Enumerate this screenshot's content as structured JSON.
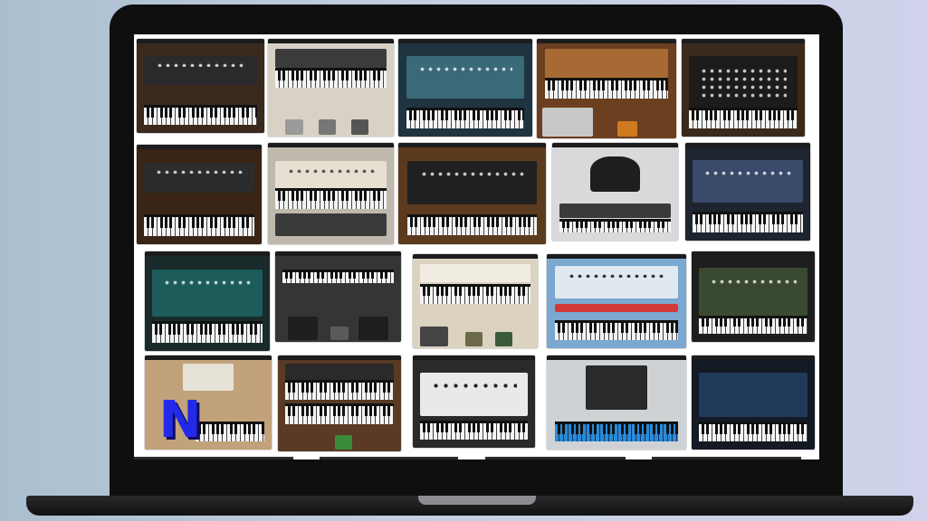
{
  "screen": {
    "content": "collage",
    "tiles": [
      {
        "name": "synth-tile-1",
        "bg": "#3a2a1e",
        "panel": "#2a2a2c"
      },
      {
        "name": "synth-tile-2",
        "bg": "#d8d2c6",
        "panel": "#3b3b3b"
      },
      {
        "name": "synth-tile-3",
        "bg": "#1e3440",
        "panel": "#3a6a78"
      },
      {
        "name": "synth-tile-4",
        "bg": "#6b3f1f",
        "panel": "#a86a34"
      },
      {
        "name": "synth-tile-5",
        "bg": "#3a2a1c",
        "panel": "#1c1c1c"
      },
      {
        "name": "synth-tile-6",
        "bg": "#3a2415",
        "panel": "#2c2c2c"
      },
      {
        "name": "synth-tile-7",
        "bg": "#bfb9ad",
        "panel": "#e6e0d2"
      },
      {
        "name": "synth-tile-8",
        "bg": "#5c3a1e",
        "panel": "#202020"
      },
      {
        "name": "synth-tile-9",
        "bg": "#d9d9db",
        "panel": "#1e1e1e"
      },
      {
        "name": "synth-tile-10",
        "bg": "#1e2430",
        "panel": "#3a4a6a"
      },
      {
        "name": "synth-tile-11",
        "bg": "#1a2a2a",
        "panel": "#1c5c5a"
      },
      {
        "name": "synth-tile-12",
        "bg": "#353535",
        "panel": "#a0a0a0"
      },
      {
        "name": "synth-tile-13",
        "bg": "#dbd2c0",
        "panel": "#f1ece2"
      },
      {
        "name": "synth-tile-14",
        "bg": "#7aa8d0",
        "panel": "#e0e8f0"
      },
      {
        "name": "synth-tile-15",
        "bg": "#1e1e1e",
        "panel": "#3a4a30"
      },
      {
        "name": "synth-tile-16",
        "bg": "#c2a27a",
        "panel": "#e6e2d8"
      },
      {
        "name": "synth-tile-17",
        "bg": "#5a3a24",
        "panel": "#2a2a2a"
      },
      {
        "name": "synth-tile-18",
        "bg": "#2a2a2a",
        "panel": "#e9e9e9"
      },
      {
        "name": "synth-tile-19",
        "bg": "#cfd2d4",
        "panel": "#2a2a2a"
      },
      {
        "name": "synth-tile-20",
        "bg": "#141a24",
        "panel": "#203a5a"
      }
    ],
    "logo_badge": {
      "text": "N",
      "color": "#2329e8"
    }
  }
}
